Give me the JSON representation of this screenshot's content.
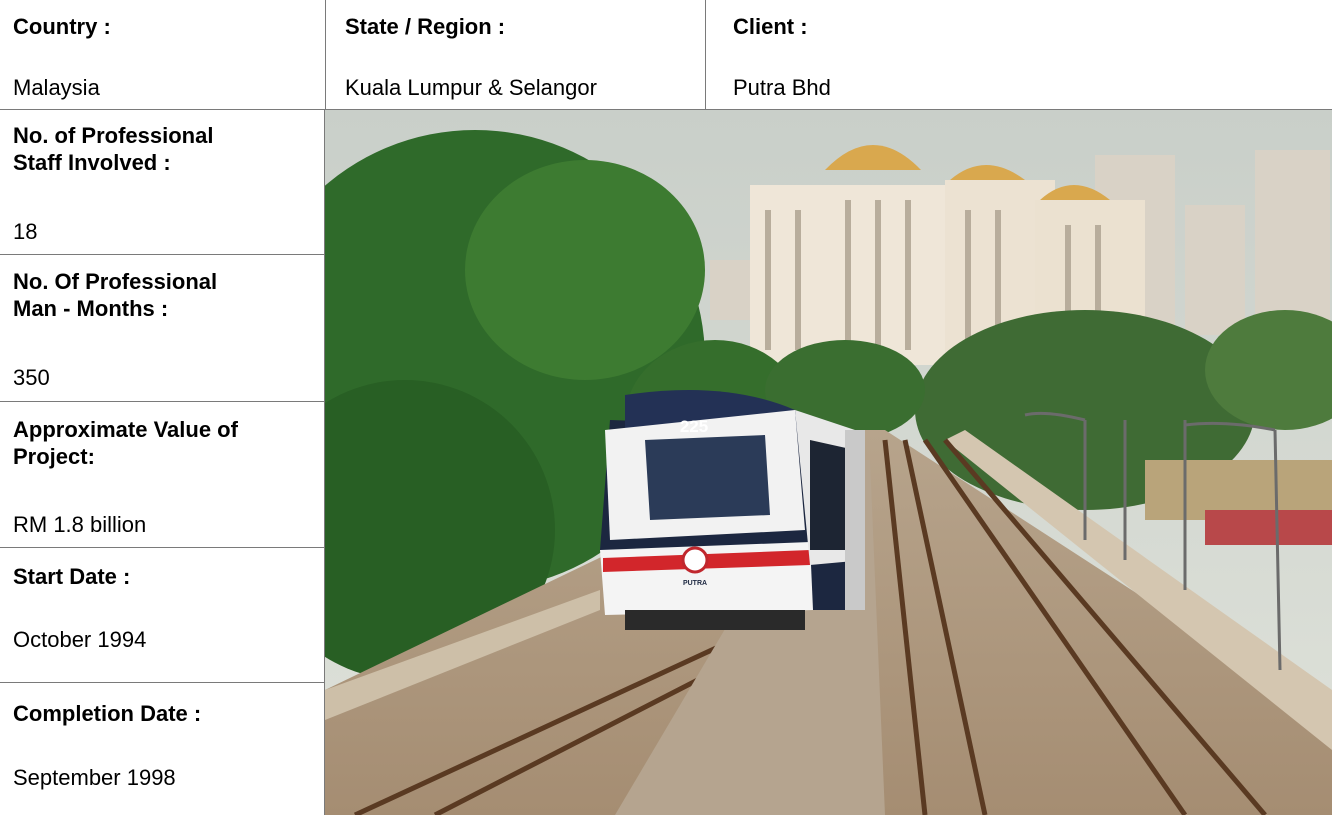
{
  "header": {
    "country_label": "Country :",
    "country_value": "Malaysia",
    "state_label": "State / Region :",
    "state_value": "Kuala Lumpur & Selangor",
    "client_label": "Client :",
    "client_value": "Putra Bhd"
  },
  "details": {
    "staff_label_1": "No. of Professional",
    "staff_label_2": "Staff Involved :",
    "staff_value": "18",
    "man_months_label_1": "No. Of Professional",
    "man_months_label_2": "Man - Months :",
    "man_months_value": "350",
    "value_label_1": "Approximate Value of",
    "value_label_2": "Project:",
    "value_value": "RM 1.8 billion",
    "start_label": "Start Date :",
    "start_value": "October 1994",
    "completion_label": "Completion Date :",
    "completion_value": "September 1998"
  },
  "photo": {
    "train_number": "225",
    "train_brand": "PUTRA"
  }
}
